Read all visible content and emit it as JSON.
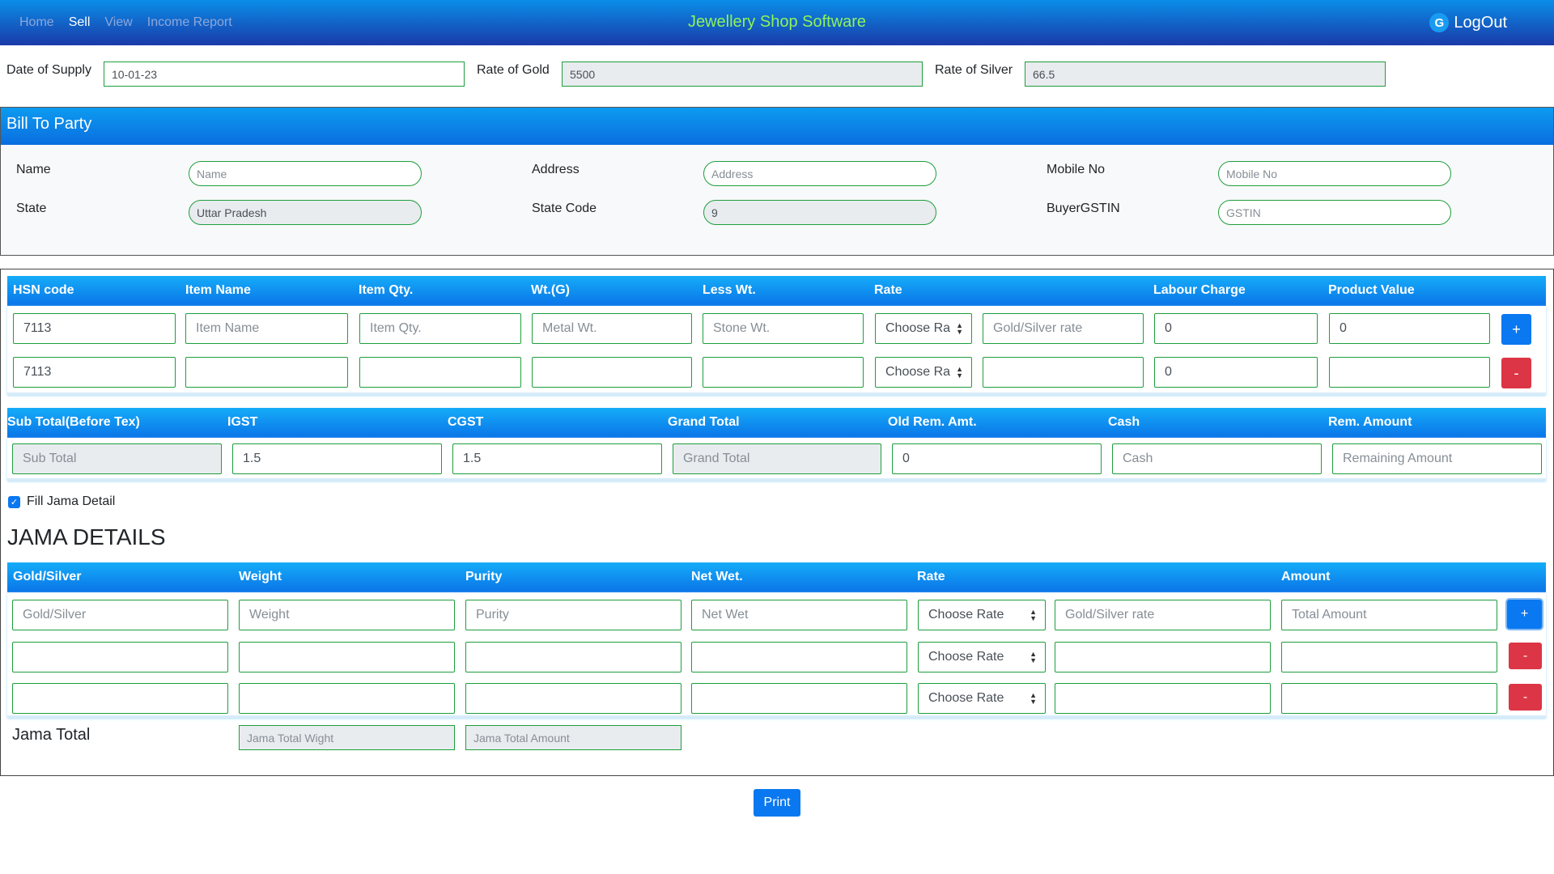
{
  "nav": {
    "links": [
      "Home",
      "Sell",
      "View",
      "Income Report"
    ],
    "active": "Sell",
    "brand": "Jewellery Shop Software",
    "logout": "LogOut",
    "logout_icon": "G"
  },
  "supply": {
    "date_label": "Date of Supply",
    "date_value": "10-01-23",
    "gold_label": "Rate of Gold",
    "gold_value": "5500",
    "silver_label": "Rate of Silver",
    "silver_value": "66.5"
  },
  "bill": {
    "title": "Bill To Party",
    "name_label": "Name",
    "name_placeholder": "Name",
    "address_label": "Address",
    "address_placeholder": "Address",
    "mobile_label": "Mobile No",
    "mobile_placeholder": "Mobile No",
    "state_label": "State",
    "state_value": "Uttar Pradesh",
    "state_code_label": "State Code",
    "state_code_value": "9",
    "gstin_label": "BuyerGSTIN",
    "gstin_placeholder": "GSTIN"
  },
  "items": {
    "headers": [
      "HSN code",
      "Item Name",
      "Item Qty.",
      "Wt.(G)",
      "Less Wt.",
      "Rate",
      "Labour Charge",
      "Product Value"
    ],
    "row1": {
      "hsn": "7113",
      "item_name_ph": "Item Name",
      "qty_ph": "Item Qty.",
      "wt_ph": "Metal Wt.",
      "less_ph": "Stone Wt.",
      "rate_select": "Choose Ra",
      "rate_ph": "Gold/Silver rate",
      "labour": "0",
      "product_value": "0",
      "btn": "+"
    },
    "row2": {
      "hsn": "7113",
      "rate_select": "Choose Ra",
      "labour": "0",
      "btn": "-"
    }
  },
  "totals": {
    "headers": [
      "Sub Total(Before Tex)",
      "IGST",
      "CGST",
      "Grand Total",
      "Old Rem. Amt.",
      "Cash",
      "Rem. Amount"
    ],
    "sub_total_ph": "Sub Total",
    "igst": "1.5",
    "cgst": "1.5",
    "grand_total_ph": "Grand Total",
    "old_rem": "0",
    "cash_ph": "Cash",
    "rem_ph": "Remaining Amount"
  },
  "jama": {
    "checkbox_label": "Fill Jama Detail",
    "checked": true,
    "heading": "JAMA DETAILS",
    "headers": [
      "Gold/Silver",
      "Weight",
      "Purity",
      "Net Wet.",
      "Rate",
      "Amount"
    ],
    "row1": {
      "gs_ph": "Gold/Silver",
      "weight_ph": "Weight",
      "purity_ph": "Purity",
      "net_ph": "Net Wet",
      "rate_select": "Choose Rate",
      "rate_ph": "Gold/Silver rate",
      "amount_ph": "Total Amount",
      "btn": "+"
    },
    "row2": {
      "rate_select": "Choose Rate",
      "btn": "-"
    },
    "row3": {
      "rate_select": "Choose Rate",
      "btn": "-"
    },
    "total_label": "Jama Total",
    "total_weight_ph": "Jama Total Wight",
    "total_amount_ph": "Jama Total Amount"
  },
  "print_label": "Print"
}
